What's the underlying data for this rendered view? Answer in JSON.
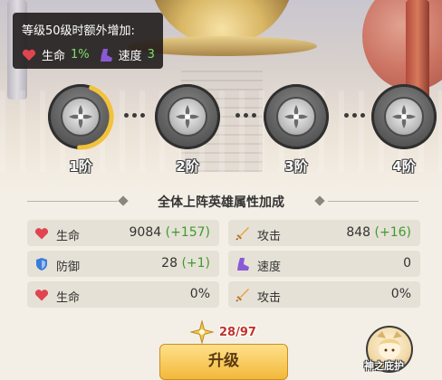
{
  "tooltip": {
    "title": "等级50级时额外增加:",
    "life_label": "生命",
    "life_value": "1%",
    "speed_label": "速度",
    "speed_value": "3"
  },
  "tiers": [
    {
      "label": "1阶",
      "progress": 0.45
    },
    {
      "label": "2阶",
      "progress": 0
    },
    {
      "label": "3阶",
      "progress": 0
    },
    {
      "label": "4阶",
      "progress": 0
    }
  ],
  "section_title": "全体上阵英雄属性加成",
  "stats": [
    {
      "name": "生命",
      "value": "9084",
      "bonus": "(+157)",
      "icon": "heart-icon"
    },
    {
      "name": "攻击",
      "value": "848",
      "bonus": "(+16)",
      "icon": "sword-icon"
    },
    {
      "name": "防御",
      "value": "28",
      "bonus": "(+1)",
      "icon": "shield-icon"
    },
    {
      "name": "速度",
      "value": "0",
      "bonus": "",
      "icon": "boot-icon"
    },
    {
      "name": "生命",
      "value": "0%",
      "bonus": "",
      "icon": "heart-icon"
    },
    {
      "name": "攻击",
      "value": "0%",
      "bonus": "",
      "icon": "sword-icon"
    }
  ],
  "star_count": "28/97",
  "upgrade_label": "升级",
  "hero_label": "神之庇护",
  "colors": {
    "bonus": "#3f9a2f",
    "progress_ring": "#f2c23a",
    "star_count": "#c0332b"
  }
}
